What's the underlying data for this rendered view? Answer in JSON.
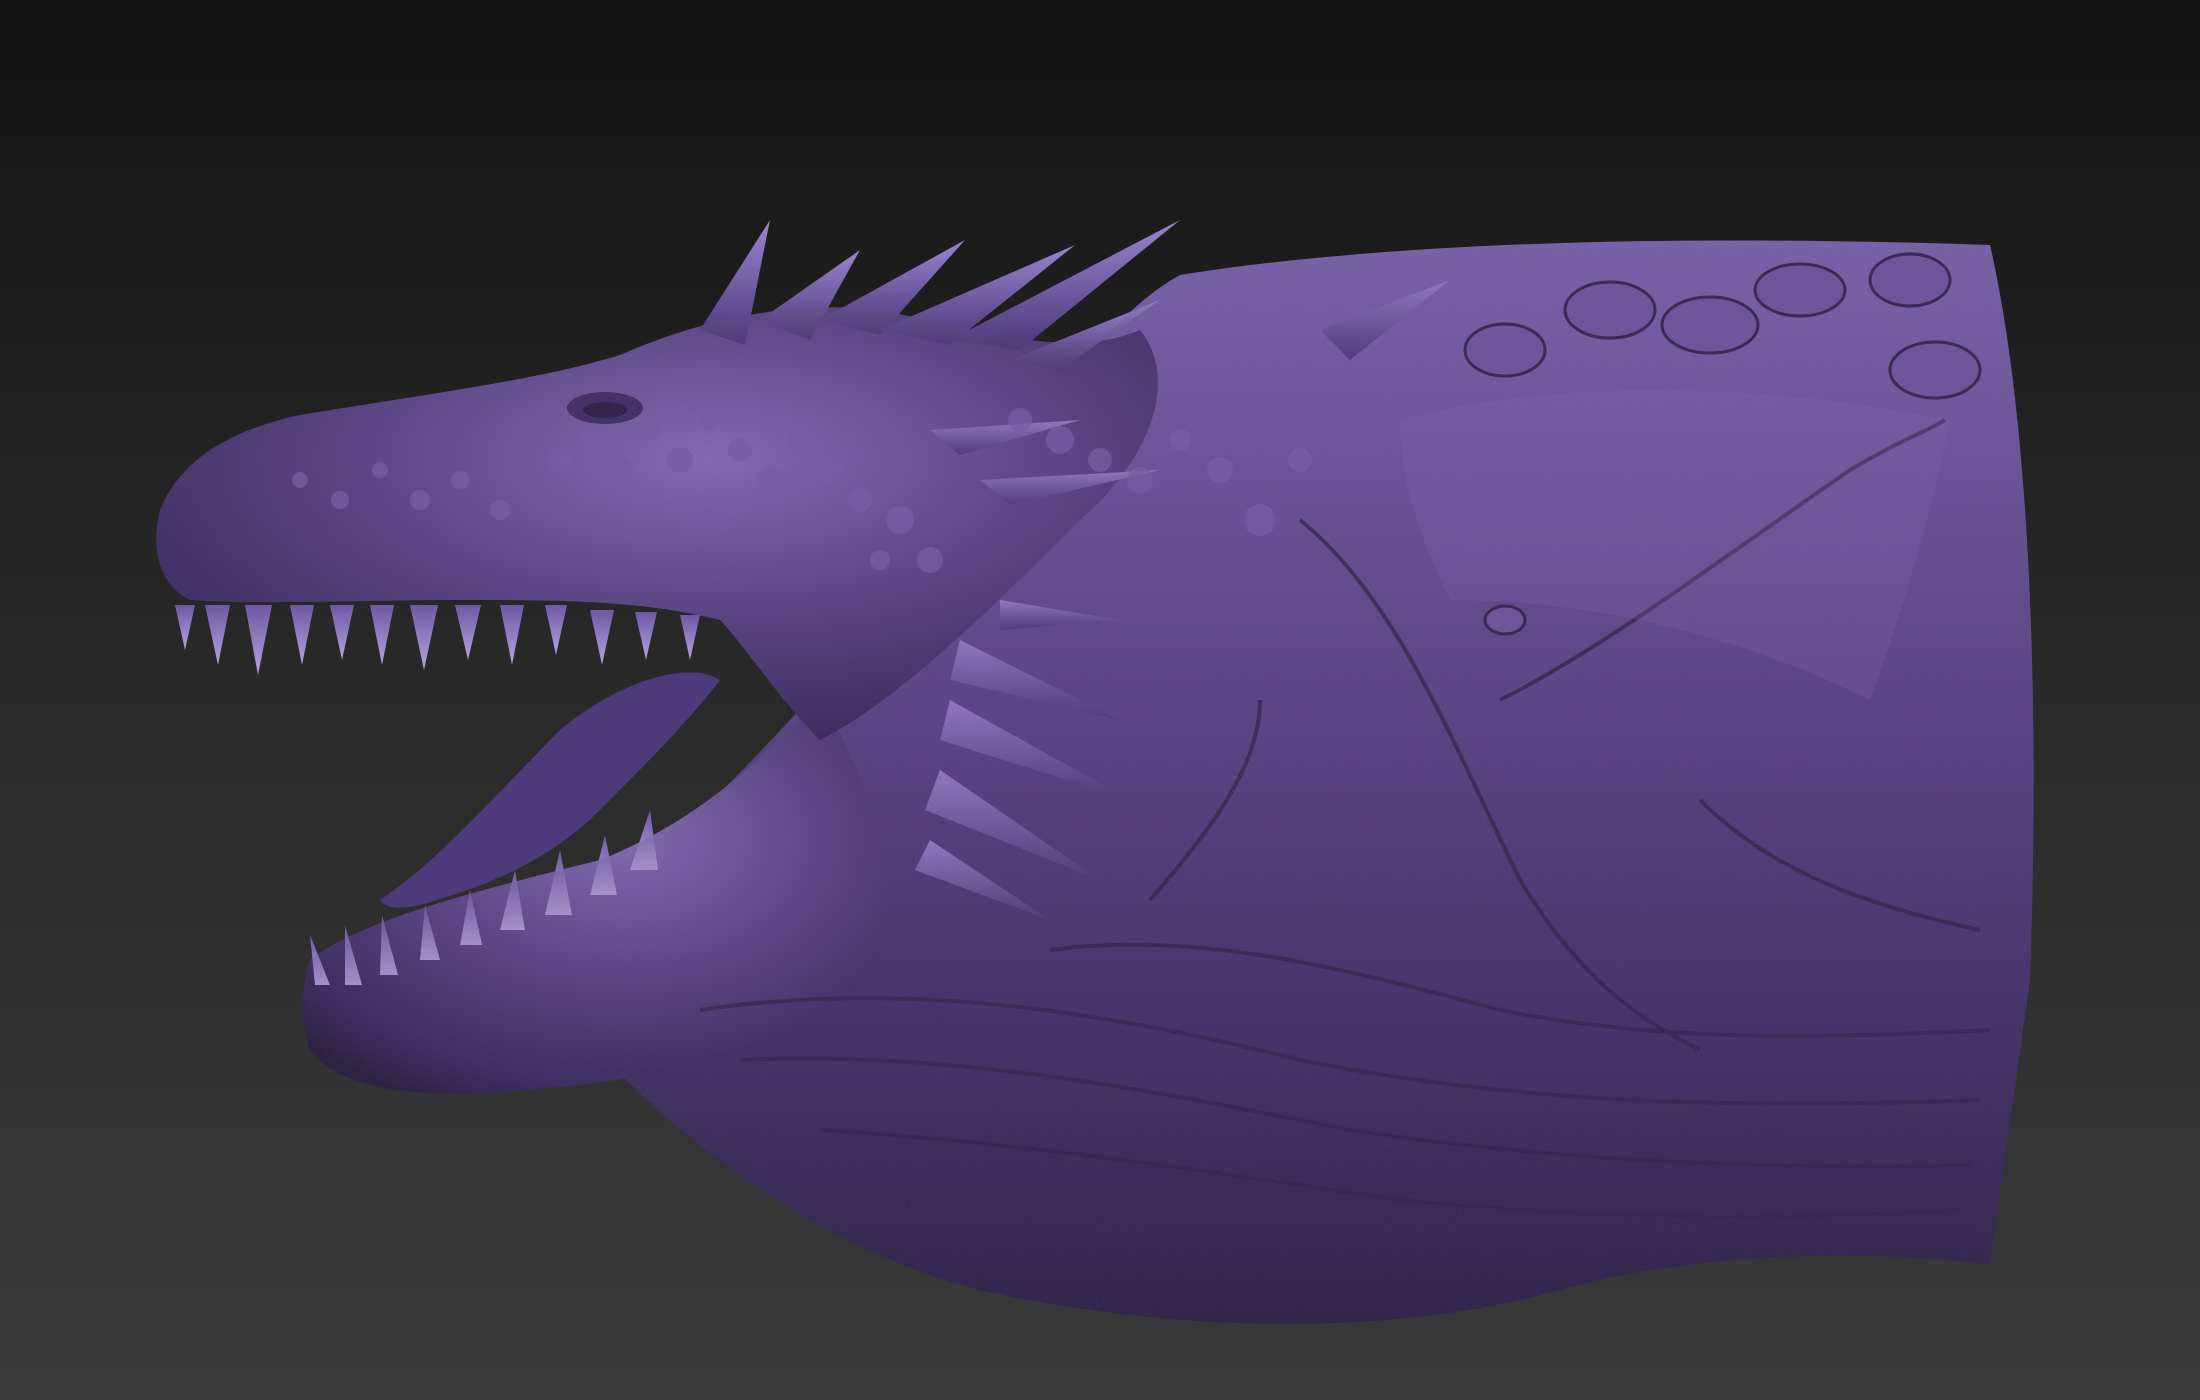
{
  "viewport": {
    "background_top": "#141414",
    "background_bottom": "#3a3a3a"
  },
  "model": {
    "subject": "dragon-head-sculpt",
    "material_color": "#5a4488",
    "highlight_color": "#8f79c4",
    "shadow_color": "#1f1633"
  }
}
